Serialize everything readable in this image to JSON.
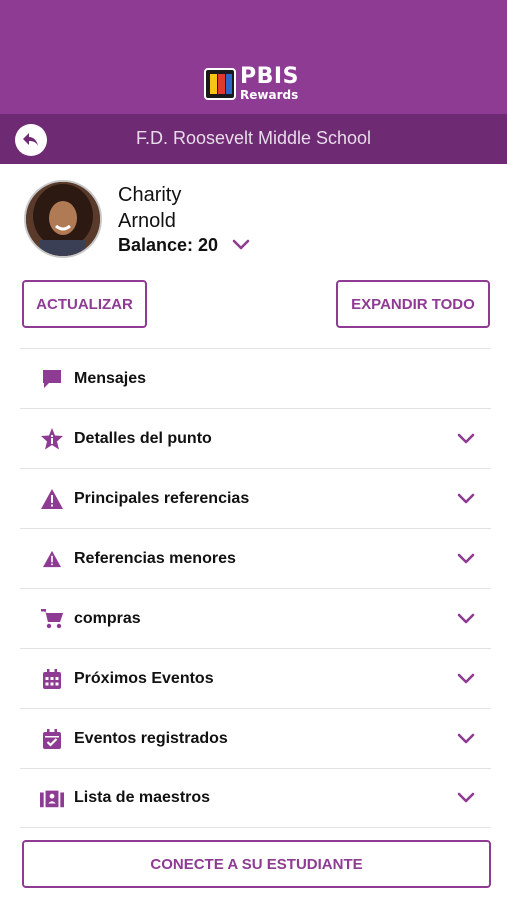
{
  "header": {
    "logo_title": "PBIS",
    "logo_subtitle": "Rewards",
    "brand_color": "#8e3b93",
    "subbar_color": "#6e2a72"
  },
  "subbar": {
    "school_name": "F.D. Roosevelt Middle School",
    "back_icon": "back-arrow-icon"
  },
  "student": {
    "first_name": "Charity",
    "last_name": "Arnold",
    "balance_label": "Balance: 20"
  },
  "actions": {
    "update_label": "ACTUALIZAR",
    "expand_label": "EXPANDIR TODO",
    "connect_label": "CONECTE A SU ESTUDIANTE"
  },
  "sections": [
    {
      "label": "Mensajes",
      "icon": "message-icon",
      "expandable": false
    },
    {
      "label": "Detalles del punto",
      "icon": "star-info-icon",
      "expandable": true
    },
    {
      "label": "Principales referencias",
      "icon": "warning-icon",
      "expandable": true
    },
    {
      "label": "Referencias menores",
      "icon": "warning-small-icon",
      "expandable": true
    },
    {
      "label": "compras",
      "icon": "cart-icon",
      "expandable": true
    },
    {
      "label": "Próximos Eventos",
      "icon": "calendar-icon",
      "expandable": true
    },
    {
      "label": "Eventos registrados",
      "icon": "calendar-check-icon",
      "expandable": true
    },
    {
      "label": "Lista de maestros",
      "icon": "teachers-icon",
      "expandable": true
    }
  ]
}
